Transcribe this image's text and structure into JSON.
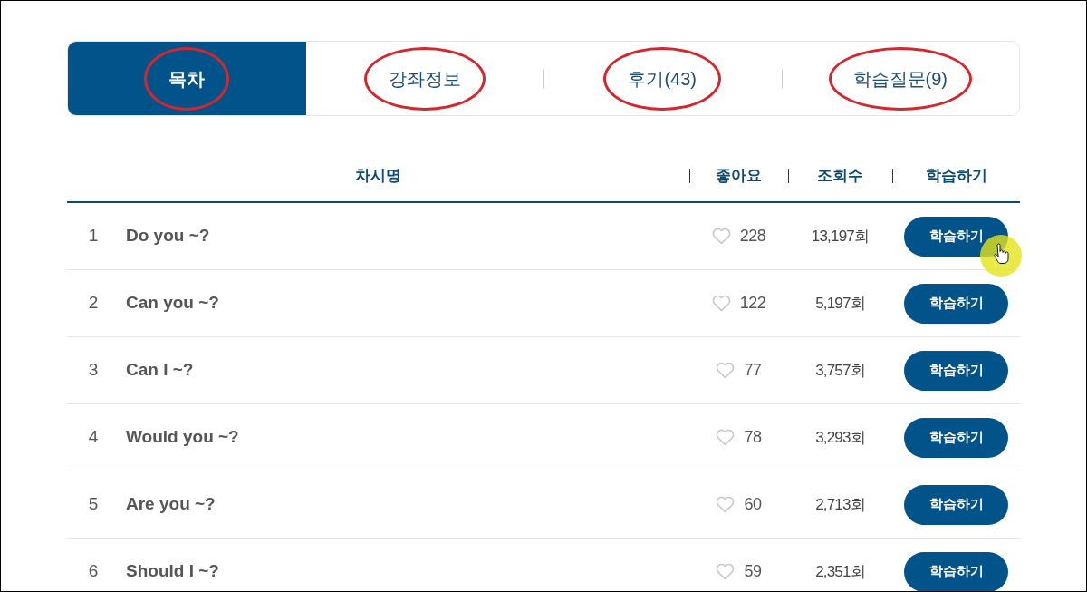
{
  "tabs": [
    {
      "label": "목차",
      "selected": true,
      "circled": true
    },
    {
      "label": "강좌정보",
      "selected": false,
      "circled": true
    },
    {
      "label": "후기(43)",
      "selected": false,
      "circled": true
    },
    {
      "label": "학습질문(9)",
      "selected": false,
      "circled": true
    }
  ],
  "table": {
    "columns": [
      "차시명",
      "좋아요",
      "조회수",
      "학습하기"
    ],
    "rows": [
      {
        "number": "1",
        "title": "Do you ~?",
        "likes": "228",
        "views": "13,197회",
        "button": "학습하기",
        "pointer": true
      },
      {
        "number": "2",
        "title": "Can you ~?",
        "likes": "122",
        "views": "5,197회",
        "button": "학습하기",
        "pointer": false
      },
      {
        "number": "3",
        "title": "Can I ~?",
        "likes": "77",
        "views": "3,757회",
        "button": "학습하기",
        "pointer": false
      },
      {
        "number": "4",
        "title": "Would you ~?",
        "likes": "78",
        "views": "3,293회",
        "button": "학습하기",
        "pointer": false
      },
      {
        "number": "5",
        "title": "Are you ~?",
        "likes": "60",
        "views": "2,713회",
        "button": "학습하기",
        "pointer": false
      },
      {
        "number": "6",
        "title": "Should I ~?",
        "likes": "59",
        "views": "2,351회",
        "button": "학습하기",
        "pointer": false
      }
    ]
  }
}
